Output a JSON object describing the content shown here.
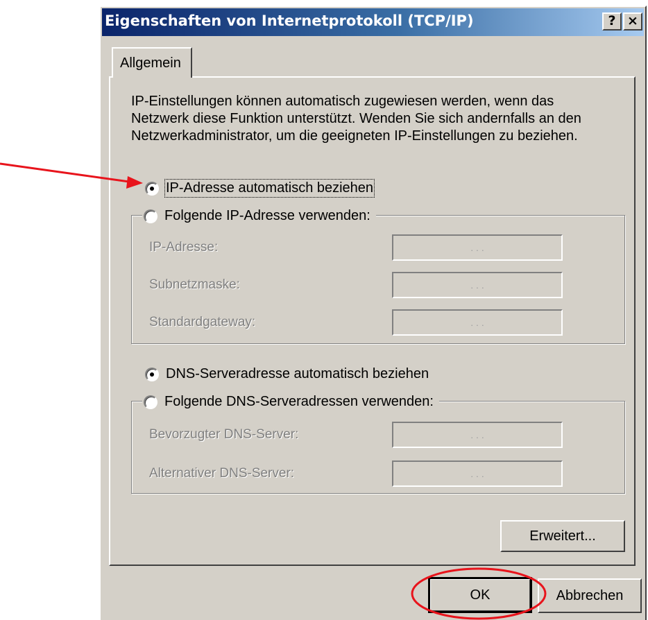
{
  "window": {
    "title": "Eigenschaften von Internetprotokoll (TCP/IP)",
    "help_button": "?",
    "close_button": "×"
  },
  "tabs": [
    {
      "label": "Allgemein",
      "selected": true
    }
  ],
  "intro_text": "IP-Einstellungen können automatisch zugewiesen werden, wenn das Netzwerk diese Funktion unterstützt. Wenden Sie sich andernfalls an den Netzwerkadministrator, um die geeigneten IP-Einstellungen zu beziehen.",
  "ip": {
    "auto_option": {
      "label": "IP-Adresse automatisch beziehen",
      "selected": true
    },
    "manual_option": {
      "label": "Folgende IP-Adresse verwenden:",
      "selected": false
    },
    "fields": [
      {
        "label": "IP-Adresse:",
        "value": ".   .   ."
      },
      {
        "label": "Subnetzmaske:",
        "value": ".   .   ."
      },
      {
        "label": "Standardgateway:",
        "value": ".   .   ."
      }
    ]
  },
  "dns": {
    "auto_option": {
      "label": "DNS-Serveradresse automatisch beziehen",
      "selected": true
    },
    "manual_option": {
      "label": "Folgende DNS-Serveradressen verwenden:",
      "selected": false
    },
    "fields": [
      {
        "label": "Bevorzugter DNS-Server:",
        "value": ".   .   ."
      },
      {
        "label": "Alternativer DNS-Server:",
        "value": ".   .   ."
      }
    ]
  },
  "buttons": {
    "advanced": "Erweitert...",
    "ok": "OK",
    "cancel": "Abbrechen"
  },
  "colors": {
    "dialog_face": "#d4d0c8",
    "titlebar_start": "#0a246a",
    "annotation_red": "#e8141c"
  }
}
